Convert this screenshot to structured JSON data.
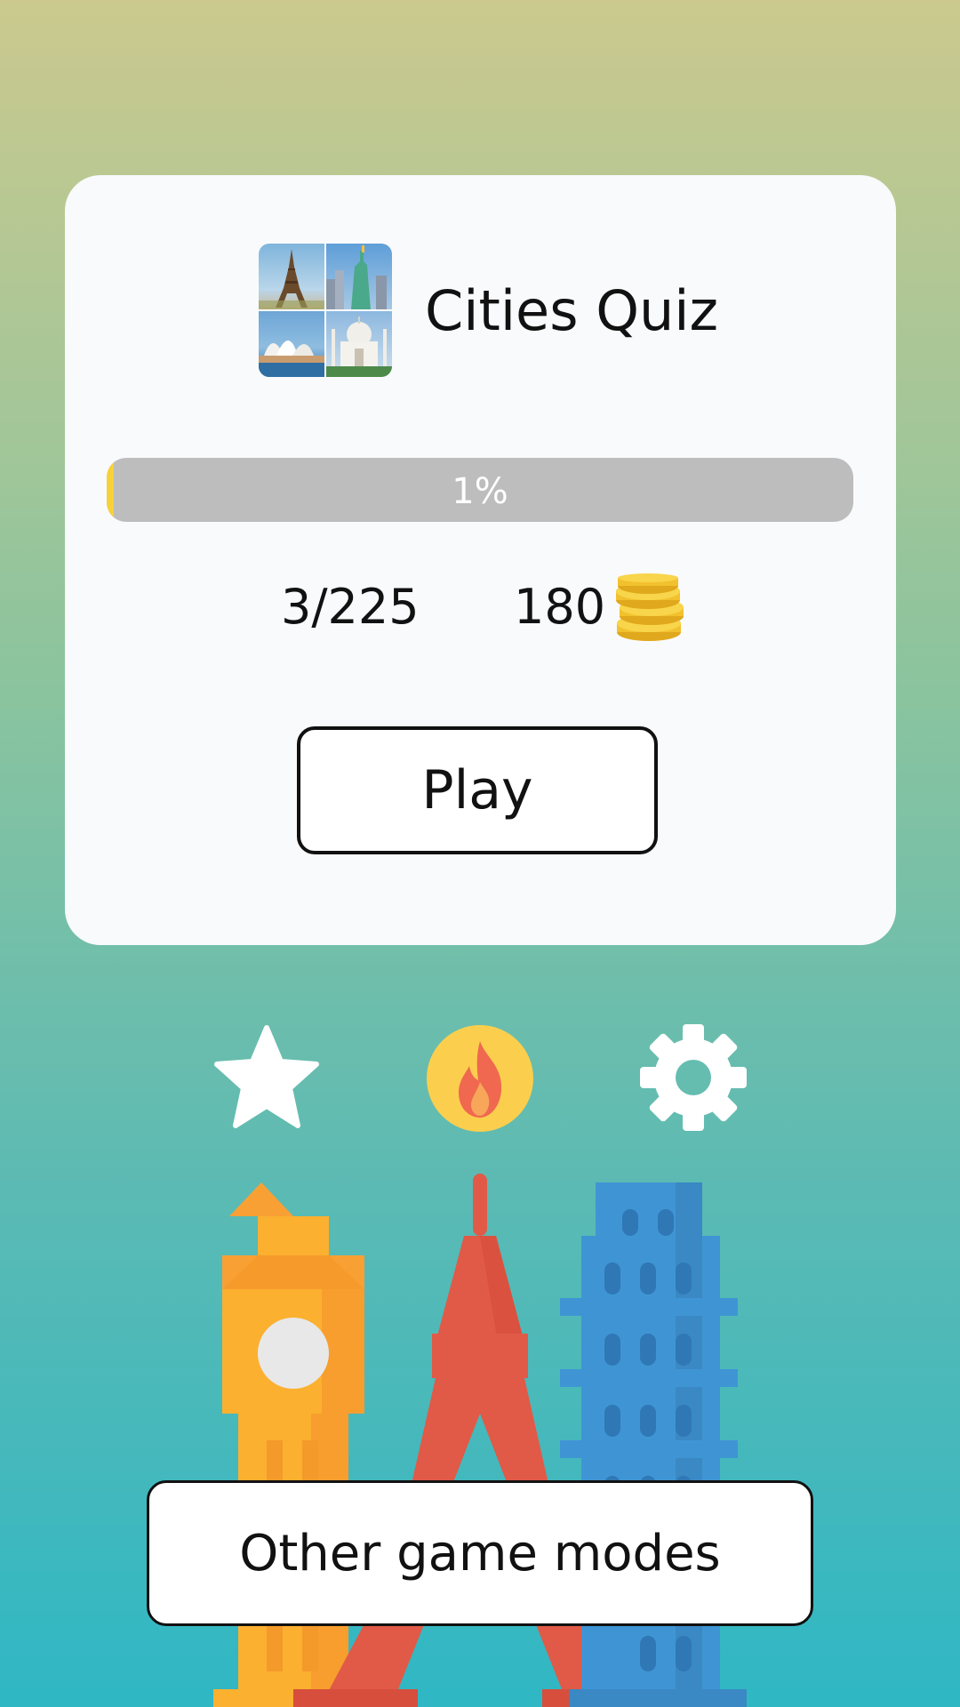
{
  "card": {
    "title": "Cities Quiz",
    "progress_percent": 1,
    "progress_label": "1%",
    "levels_progress": "3/225",
    "coins": "180",
    "play_label": "Play"
  },
  "icons": {
    "favorites": "star-icon",
    "hot": "fire-icon",
    "settings": "gear-icon",
    "coins": "coins-icon"
  },
  "bottom": {
    "other_modes_label": "Other game modes"
  },
  "colors": {
    "progress_fill": "#f7d13a",
    "progress_track": "#bdbdbd",
    "fire_circle": "#fbcf4d",
    "fire": "#f0684f",
    "tower_red": "#e05a47",
    "clock_tower": "#fbb030",
    "skyscraper": "#3f95d4"
  }
}
